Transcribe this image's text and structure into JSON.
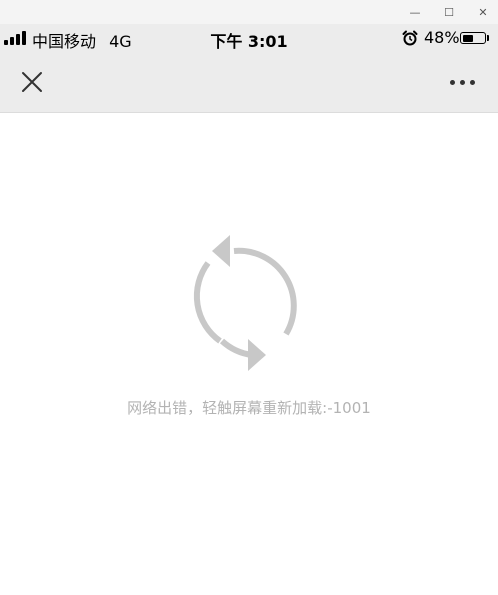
{
  "window_controls": {
    "minimize_glyph": "—",
    "maximize_glyph": "☐",
    "close_glyph": "✕"
  },
  "status_bar": {
    "carrier": "中国移动",
    "network": "4G",
    "time": "下午 3:01",
    "battery_percent": "48%",
    "battery_level": 0.48
  },
  "nav": {
    "close_icon": "close-icon",
    "more_icon": "more-dots-icon"
  },
  "content": {
    "error_message": "网络出错，轻触屏幕重新加载:-1001",
    "reload_icon": "refresh-icon",
    "icon_color": "#c8c8c8"
  }
}
